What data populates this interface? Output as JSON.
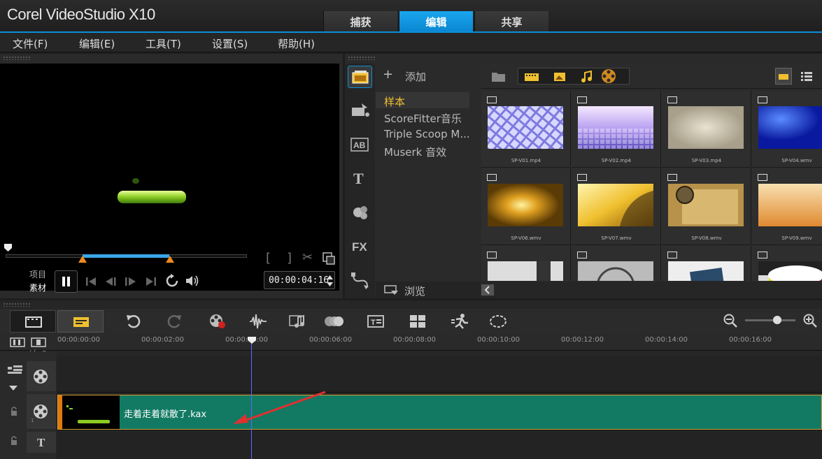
{
  "app": {
    "title": "Corel VideoStudio X10"
  },
  "main_tabs": [
    {
      "label": "捕获",
      "active": false
    },
    {
      "label": "编辑",
      "active": true
    },
    {
      "label": "共享",
      "active": false
    }
  ],
  "menu": [
    "文件(F)",
    "编辑(E)",
    "工具(T)",
    "设置(S)",
    "帮助(H)"
  ],
  "player": {
    "mode_project": "项目",
    "mode_clip": "素材",
    "timecode": "00:00:04:16"
  },
  "library": {
    "add_label": "添加",
    "folders": [
      "样本",
      "ScoreFitter音乐",
      "Triple Scoop M...",
      "Muserk 音效"
    ],
    "browse_label": "浏览",
    "thumbnails": [
      {
        "label": "SP-V01.mp4"
      },
      {
        "label": "SP-V02.mp4"
      },
      {
        "label": "SP-V03.mp4"
      },
      {
        "label": "SP-V04.wmv"
      },
      {
        "label": "SP-V06.wmv"
      },
      {
        "label": "SP-V07.wmv"
      },
      {
        "label": "SP-V08.wmv"
      },
      {
        "label": "SP-V09.wmv"
      },
      {
        "label": ""
      },
      {
        "label": ""
      },
      {
        "label": ""
      },
      {
        "label": ""
      }
    ]
  },
  "timeline": {
    "ruler": [
      "00:00:00:00",
      "00:00:02:00",
      "00:00:04:00",
      "00:00:06:00",
      "00:00:08:00",
      "00:00:10:00",
      "00:00:12:00",
      "00:00:14:00",
      "00:00:16:00"
    ],
    "clip_name": "走着走着就散了.kax",
    "track_number": "1",
    "add_remove": "+/− ▾"
  },
  "colors": {
    "accent": "#0b8fd9",
    "clip": "#127a63",
    "folder_active": "#f0c030",
    "arrow": "#e03030"
  }
}
